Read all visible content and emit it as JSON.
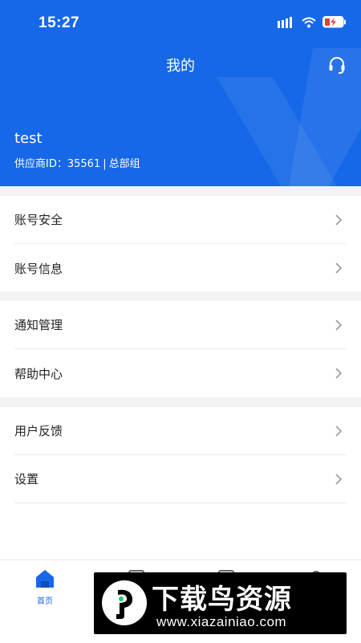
{
  "status_bar": {
    "time": "15:27"
  },
  "header": {
    "title": "我的",
    "username": "test",
    "supplier_label": "供应商ID：",
    "supplier_id": "35561",
    "separator": "|",
    "group": "总部组"
  },
  "menu": {
    "sections": [
      {
        "items": [
          {
            "label": "账号安全"
          },
          {
            "label": "账号信息"
          }
        ]
      },
      {
        "items": [
          {
            "label": "通知管理"
          },
          {
            "label": "帮助中心"
          }
        ]
      },
      {
        "items": [
          {
            "label": "用户反馈"
          },
          {
            "label": "设置"
          }
        ]
      }
    ]
  },
  "tabbar": {
    "home_label": "首页"
  },
  "watermark": {
    "title": "下载鸟资源",
    "url": "www.xiazainiao.com"
  },
  "colors": {
    "primary": "#1668e8",
    "section_gap": "#f2f3f5",
    "text": "#222222",
    "chevron": "#9a9a9a"
  }
}
